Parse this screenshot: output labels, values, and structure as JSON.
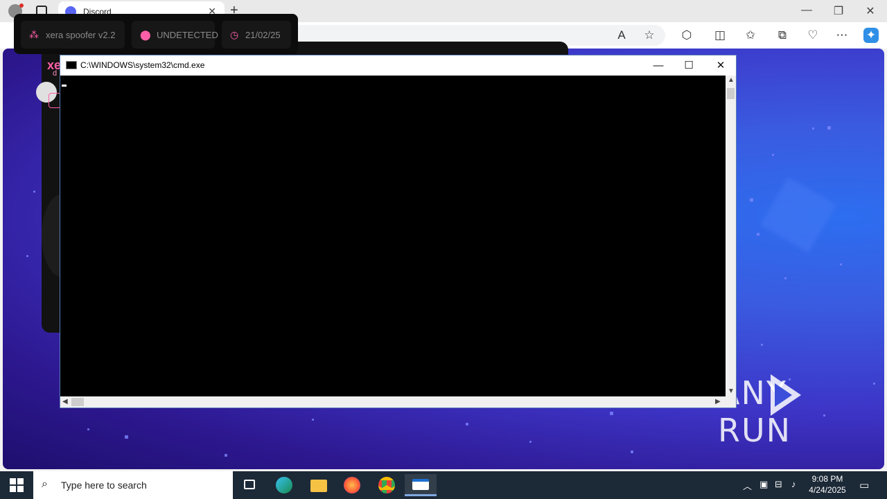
{
  "browser": {
    "tab_title": "Discord",
    "tab_close": "✕",
    "new_tab": "+",
    "window_controls": {
      "minimize": "—",
      "restore": "❐",
      "close": "✕"
    }
  },
  "spoofer": {
    "heading": "xe",
    "sub": "d",
    "status_items": [
      {
        "icon": "network-icon",
        "text": "xera spoofer v2.2"
      },
      {
        "icon": "location-pin-icon",
        "text": "UNDETECTED"
      },
      {
        "icon": "clock-icon",
        "text": "21/02/25"
      }
    ]
  },
  "cmd": {
    "title": "C:\\WINDOWS\\system32\\cmd.exe",
    "minimize": "—",
    "maximize": "☐",
    "close": "✕"
  },
  "watermark": {
    "left": "ANY",
    "right": "RUN"
  },
  "taskbar": {
    "search_placeholder": "Type here to search",
    "time": "9:08 PM",
    "date": "4/24/2025"
  },
  "colors": {
    "accent_pink": "#ff5fa8",
    "taskbar": "#1c2937",
    "discord": "#5865f2"
  }
}
